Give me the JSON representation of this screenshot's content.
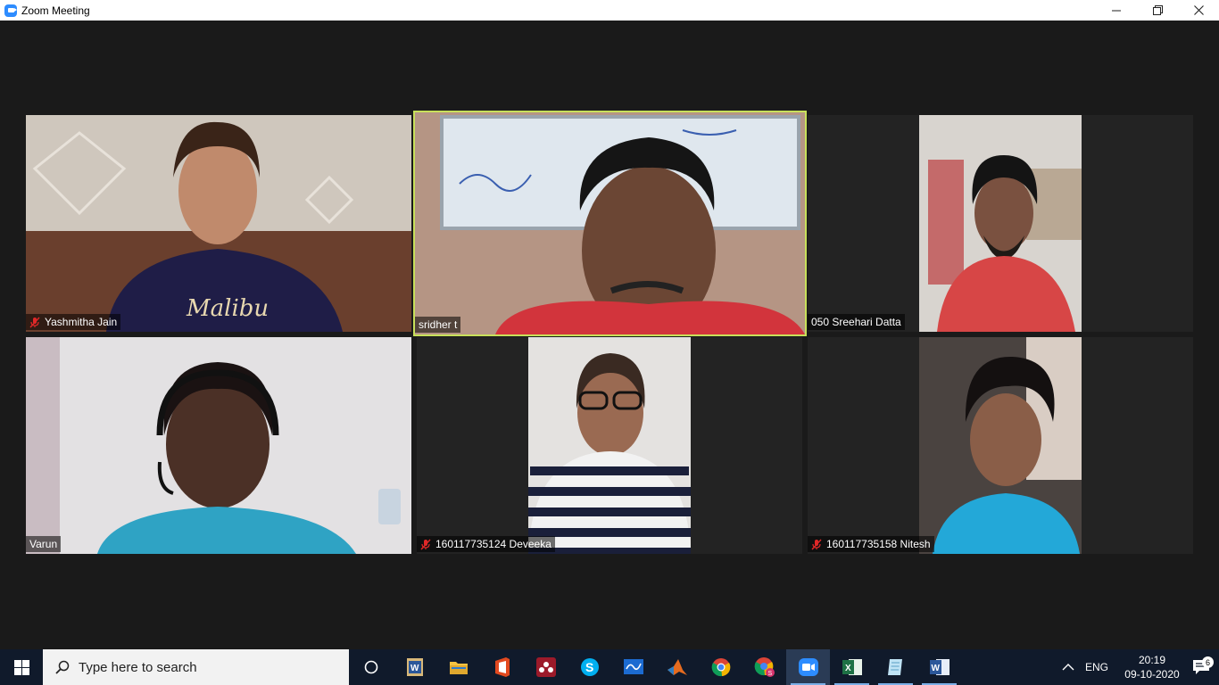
{
  "window": {
    "title": "Zoom Meeting",
    "minimize": "—",
    "restore": "❐",
    "close": "✕"
  },
  "participants": [
    {
      "name": "Yashmitha Jain",
      "muted": true,
      "active": false
    },
    {
      "name": "sridher t",
      "muted": false,
      "active": true
    },
    {
      "name": "050 Sreehari Datta",
      "muted": false,
      "active": false
    },
    {
      "name": "Varun",
      "muted": false,
      "active": false
    },
    {
      "name": "160117735124 Deveeka",
      "muted": true,
      "active": false
    },
    {
      "name": "160117735158 Nitesh",
      "muted": true,
      "active": false
    }
  ],
  "taskbar": {
    "search_placeholder": "Type here to search",
    "apps": [
      {
        "name": "task-view",
        "label": ""
      },
      {
        "name": "word-doc",
        "label": "W"
      },
      {
        "name": "file-explorer",
        "label": ""
      },
      {
        "name": "office",
        "label": ""
      },
      {
        "name": "mendeley",
        "label": ""
      },
      {
        "name": "skype",
        "label": "S"
      },
      {
        "name": "whiteboard",
        "label": ""
      },
      {
        "name": "matlab",
        "label": ""
      },
      {
        "name": "chrome",
        "label": ""
      },
      {
        "name": "chrome-profile",
        "label": ""
      },
      {
        "name": "zoom",
        "label": ""
      },
      {
        "name": "excel",
        "label": "X"
      },
      {
        "name": "notepad",
        "label": ""
      },
      {
        "name": "word",
        "label": "W"
      }
    ],
    "tray": {
      "language": "ENG",
      "time": "20:19",
      "date": "09-10-2020",
      "notification_count": "6"
    }
  },
  "colors": {
    "meeting_bg": "#1a1a1a",
    "active_speaker_border": "#c8e05a",
    "mute_red": "#e02828",
    "taskbar_bg": "#101a2b",
    "zoom_blue": "#2d8cff"
  }
}
